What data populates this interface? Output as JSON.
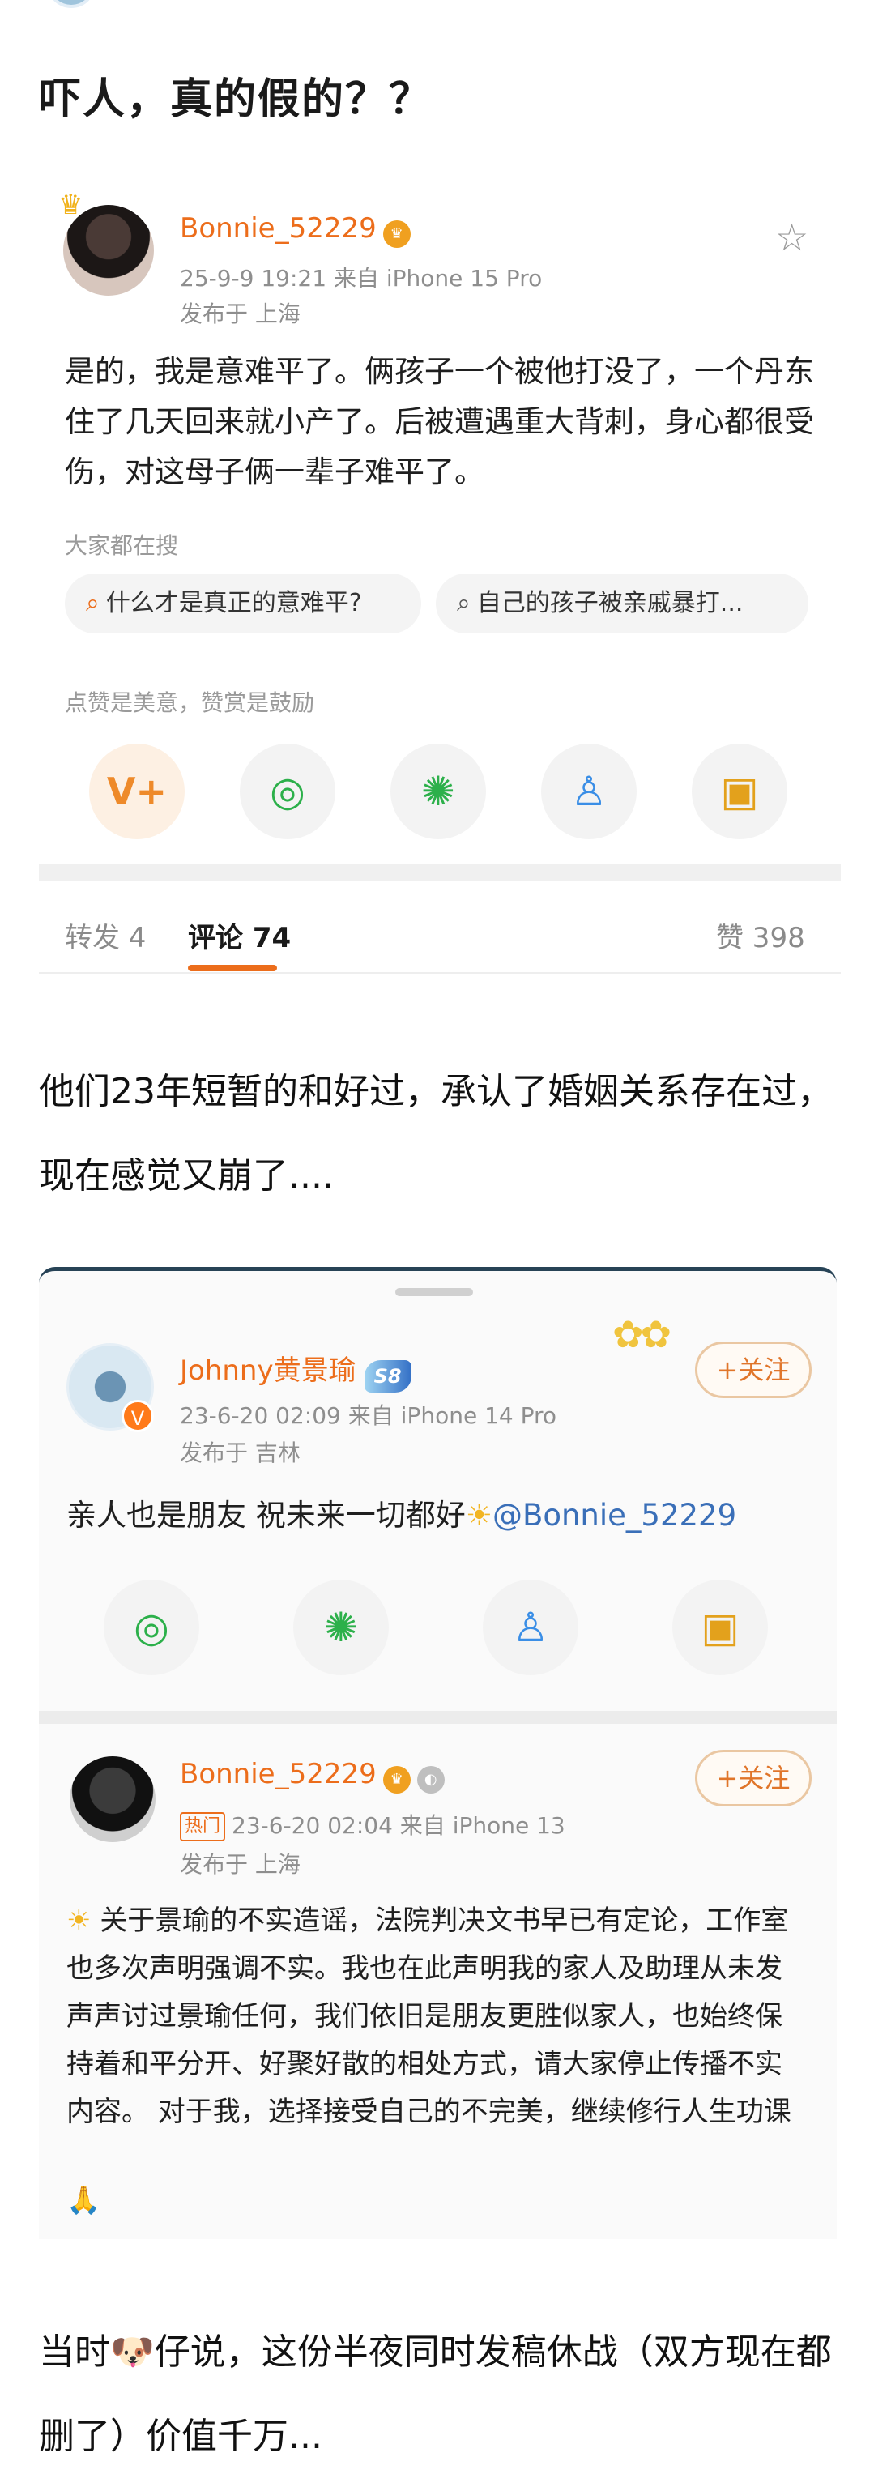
{
  "heading": "吓人，真的假的？？",
  "post": {
    "username": "Bonnie_52229",
    "time_source": "25-9-9 19:21  来自 iPhone 15 Pro",
    "location": "发布于 上海",
    "text": "是的，我是意难平了。俩孩子一个被他打没了，一个丹东住了几天回来就小产了。后被遭遇重大背刺，身心都很受伤，对这母子俩一辈子难平了。",
    "search_label": "大家都在搜",
    "search_chips": [
      "什么才是真正的意难平?",
      "自己的孩子被亲戚暴打..."
    ],
    "reward_label": "点赞是美意，赞赏是鼓励",
    "share_icons": [
      "v-plus-icon",
      "wechat-icon",
      "moments-icon",
      "qq-icon",
      "save-image-icon"
    ]
  },
  "tabs": {
    "repost": "转发 4",
    "comments": "评论 74",
    "likes": "赞 398"
  },
  "paragraph_1": "他们23年短暂的和好过，承认了婚姻关系存在过，现在感觉又崩了....",
  "inner_post_1": {
    "username": "Johnny黄景瑜",
    "level_badge": "S8",
    "time_source": "23-6-20 02:09  来自 iPhone 14 Pro",
    "location": "发布于 吉林",
    "follow": "+关注",
    "text": "亲人也是朋友 祝未来一切都好",
    "mention": "@Bonnie_52229"
  },
  "inner_post_2": {
    "username": "Bonnie_52229",
    "hot_tag": "热门",
    "time_source": "23-6-20 02:04  来自 iPhone 13",
    "location": "发布于 上海",
    "follow": "+关注",
    "text": "关于景瑜的不实造谣，法院判决文书早已有定论，工作室也多次声明强调不实。我也在此声明我的家人及助理从未发声声讨过景瑜任何，我们依旧是朋友更胜似家人，也始终保持着和平分开、好聚好散的相处方式，请大家停止传播不实内容。 对于我，选择接受自己的不完美，继续修行人生功课"
  },
  "paragraph_2": "当时🐶仔说，这份半夜同时发稿休战（双方现在都删了）价值千万..."
}
